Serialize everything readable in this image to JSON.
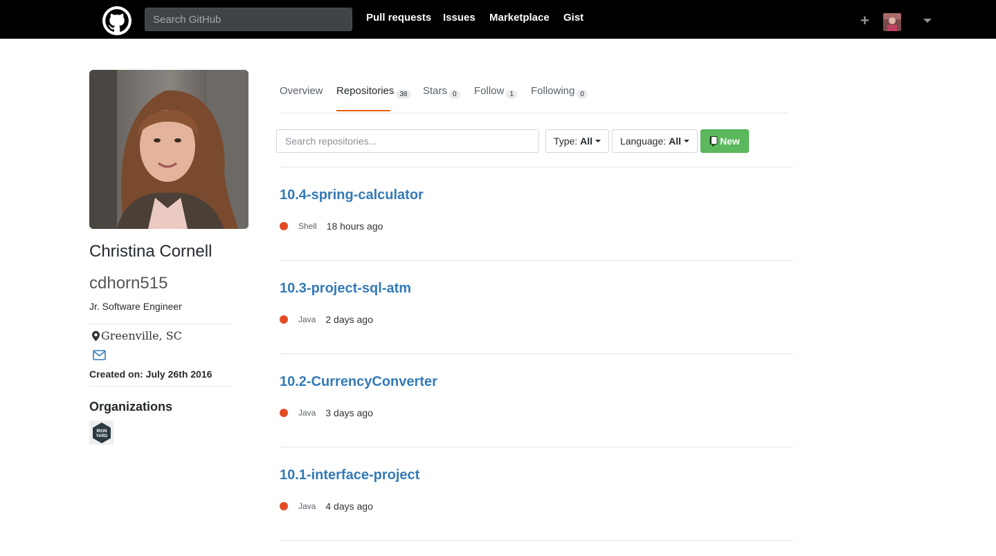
{
  "header": {
    "search_placeholder": "Search GitHub",
    "nav": [
      "Pull requests",
      "Issues",
      "Marketplace",
      "Gist"
    ],
    "plus": "+"
  },
  "profile": {
    "full_name": "Christina Cornell",
    "username": "cdhorn515",
    "bio": "Jr. Software Engineer",
    "location": "Greenville, SC",
    "created": "Created on: July 26th 2016",
    "organizations_title": "Organizations",
    "org_badge_text": "IRON YARD"
  },
  "tabs": [
    {
      "label": "Overview",
      "count": null
    },
    {
      "label": "Repositories",
      "count": "38"
    },
    {
      "label": "Stars",
      "count": "0"
    },
    {
      "label": "Follow",
      "count": "1"
    },
    {
      "label": "Following",
      "count": "0"
    }
  ],
  "filters": {
    "search_placeholder": "Search repositories...",
    "type_label": "Type:",
    "type_value": "All",
    "language_label": "Language:",
    "language_value": "All",
    "new_label": "New"
  },
  "repos": [
    {
      "name": "10.4-spring-calculator",
      "language": "Shell",
      "updated": "18 hours ago"
    },
    {
      "name": "10.3-project-sql-atm",
      "language": "Java",
      "updated": "2 days ago"
    },
    {
      "name": "10.2-CurrencyConverter",
      "language": "Java",
      "updated": "3 days ago"
    },
    {
      "name": "10.1-interface-project",
      "language": "Java",
      "updated": "4 days ago"
    }
  ],
  "colors": {
    "accent_tab": "#e36209",
    "link": "#337ab7",
    "new_button": "#5cb85c",
    "language_dot": "#e44b23"
  }
}
